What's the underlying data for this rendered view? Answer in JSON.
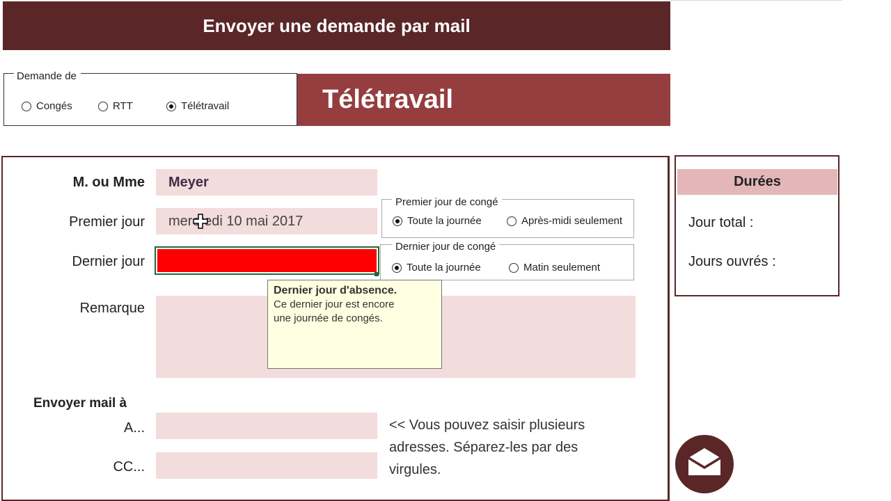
{
  "header": {
    "title": "Envoyer une demande  par mail"
  },
  "demande": {
    "legend": "Demande de",
    "options": [
      {
        "label": "Congés",
        "selected": false
      },
      {
        "label": "RTT",
        "selected": false
      },
      {
        "label": "Télétravail",
        "selected": true
      }
    ]
  },
  "type_banner": "Télétravail",
  "form": {
    "name_label": "M. ou Mme",
    "name_value": "Meyer",
    "first_day_label": "Premier jour",
    "first_day_value": "mercredi 10 mai 2017",
    "last_day_label": "Dernier jour",
    "last_day_value": "",
    "remark_label": "Remarque",
    "remark_value": "",
    "send_label": "Envoyer mail à",
    "to_label": "A...",
    "to_value": "",
    "cc_label": "CC...",
    "cc_value": "",
    "note": "<< Vous pouvez saisir plusieurs adresses. Séparez-les par des virgules."
  },
  "first_day_group": {
    "legend": "Premier jour de congé",
    "options": [
      {
        "label": "Toute la journée",
        "selected": true
      },
      {
        "label": "Après-midi seulement",
        "selected": false
      }
    ]
  },
  "last_day_group": {
    "legend": "Dernier jour de congé",
    "options": [
      {
        "label": "Toute la journée",
        "selected": true
      },
      {
        "label": "Matin seulement",
        "selected": false
      }
    ]
  },
  "tooltip": {
    "title": "Dernier jour d'absence.",
    "line1": "Ce dernier jour est encore",
    "line2": "une journée de congés."
  },
  "durees": {
    "title": "Durées",
    "total_label": "Jour total :",
    "worked_label": "Jours  ouvrés :"
  },
  "icons": {
    "send_mail": "envelope-icon",
    "cursor": "cell-cursor-icon"
  },
  "colors": {
    "header_bg": "#5b2628",
    "banner_bg": "#953d3f",
    "field_bg": "#f2dcdc",
    "active_cell": "#ff0000",
    "durees_head": "#e3b6b8",
    "tooltip_bg": "#ffffe1"
  }
}
